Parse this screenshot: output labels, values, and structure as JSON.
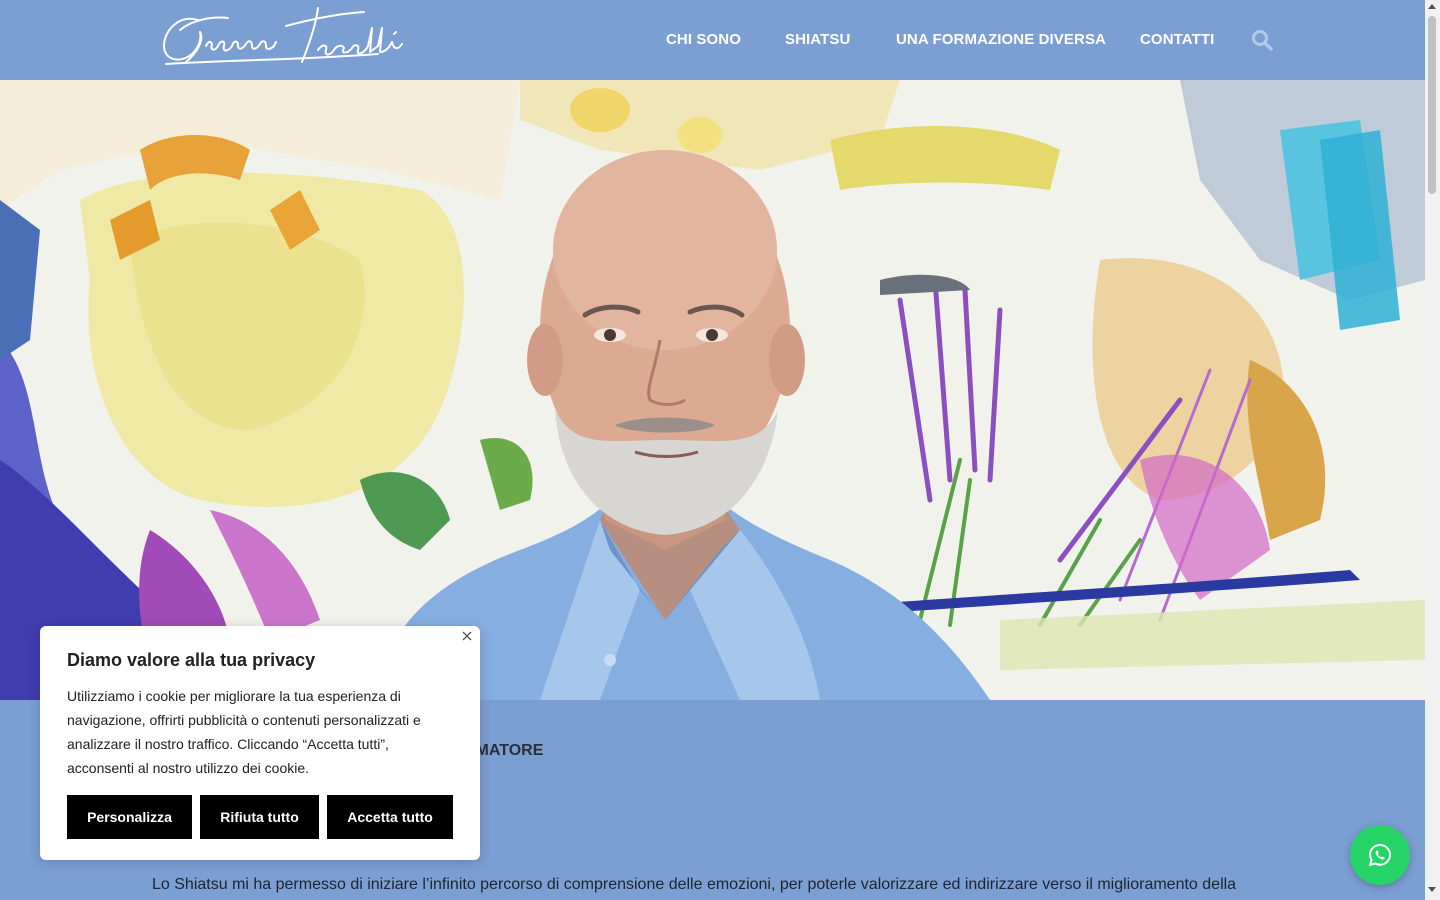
{
  "header": {
    "logo_text": "Gianni Toselli",
    "nav": [
      {
        "label": "CHI SONO"
      },
      {
        "label": "SHIATSU"
      },
      {
        "label": "UNA FORMAZIONE DIVERSA"
      },
      {
        "label": "CONTATTI"
      }
    ],
    "search_icon": "search-icon"
  },
  "hero": {
    "image": "portrait of a bald bearded man in a light blue shirt in front of a colourful painting"
  },
  "content": {
    "subtitle_visible": "RMATORE",
    "body_text": "Lo Shiatsu mi ha permesso di iniziare l’infinito percorso di comprensione delle emozioni, per poterle valorizzare ed indirizzare verso il miglioramento della"
  },
  "cookie_banner": {
    "title": "Diamo valore alla tua privacy",
    "text": "Utilizziamo i cookie per migliorare la tua esperienza di navigazione, offrirti pubblicità o contenuti personalizzati e analizzare il nostro traffico. Cliccando “Accetta tutti”, acconsenti al nostro utilizzo dei cookie.",
    "buttons": {
      "customize": "Personalizza",
      "reject": "Rifiuta tutto",
      "accept": "Accetta tutto"
    },
    "close_icon": "close-icon"
  },
  "whatsapp": {
    "icon": "whatsapp-icon",
    "color": "#25d366"
  },
  "colors": {
    "brand_blue": "#7b9ed3",
    "white": "#ffffff",
    "black": "#000000"
  }
}
